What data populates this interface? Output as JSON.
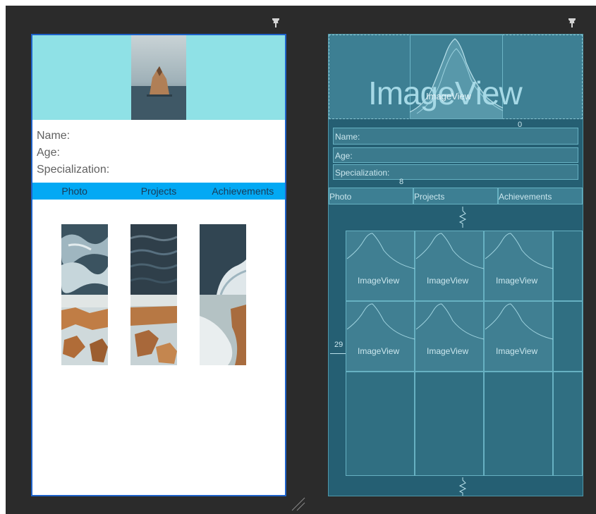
{
  "design": {
    "info_lines": [
      "Name:",
      "Age:",
      "Specialization:"
    ],
    "tabs": [
      "Photo",
      "Projects",
      "Achievements"
    ]
  },
  "blueprint": {
    "header_big_label": "ImageView",
    "header_small_label": "ImageView",
    "info_lines": [
      "Name:",
      "Age:",
      "Specialization:"
    ],
    "tabs": [
      "Photo",
      "Projects",
      "Achievements"
    ],
    "grid_labels": [
      "ImageView",
      "ImageView",
      "ImageView",
      "ImageView",
      "ImageView",
      "ImageView"
    ],
    "margin_label_left": "29",
    "margin_label_top": "8",
    "margin_label_zero": "0"
  },
  "colors": {
    "canvas": "#2b2b2b",
    "header_bg": "#8fe1e6",
    "tab_bar": "#03a9f4",
    "blueprint_bg": "#255f73",
    "blueprint_line": "#67b1c2",
    "selection": "#1e62c9"
  },
  "icons": [
    "pin-icon",
    "resize-handle-icon",
    "mountain-placeholder-icon",
    "zigzag-constraint-icon"
  ]
}
